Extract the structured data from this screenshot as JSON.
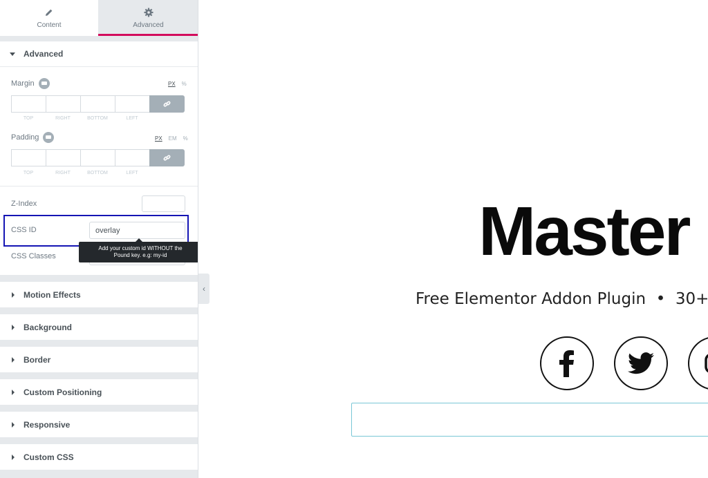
{
  "tabs": [
    {
      "label": "Content",
      "icon": "pencil-icon"
    },
    {
      "label": "Advanced",
      "icon": "gear-icon",
      "active": true
    }
  ],
  "advanced": {
    "title": "Advanced",
    "margin": {
      "label": "Margin",
      "units": [
        "PX",
        "%"
      ],
      "active_unit": "PX",
      "sides": [
        "TOP",
        "RIGHT",
        "BOTTOM",
        "LEFT"
      ]
    },
    "padding": {
      "label": "Padding",
      "units": [
        "PX",
        "EM",
        "%"
      ],
      "active_unit": "PX",
      "sides": [
        "TOP",
        "RIGHT",
        "BOTTOM",
        "LEFT"
      ]
    },
    "z_index": {
      "label": "Z-Index",
      "value": ""
    },
    "css_id": {
      "label": "CSS ID",
      "value": "overlay"
    },
    "css_classes": {
      "label": "CSS Classes",
      "value": ""
    },
    "tooltip": {
      "line1": "Add your custom id WITHOUT the",
      "line2": "Pound key. e.g: my-id"
    }
  },
  "sections": [
    "Motion Effects",
    "Background",
    "Border",
    "Custom Positioning",
    "Responsive",
    "Custom CSS"
  ],
  "preview": {
    "title": "Master",
    "subtitle": "Free Elementor Addon Plugin  •  30+",
    "social_icons": [
      "facebook-icon",
      "twitter-icon",
      "instagram-icon"
    ]
  },
  "colors": {
    "accent": "#d30c5c",
    "highlight_box": "#1414b4",
    "tooltip_bg": "#24282c",
    "panel_bg": "#e6e9ec",
    "form_border": "#78c7d6"
  }
}
